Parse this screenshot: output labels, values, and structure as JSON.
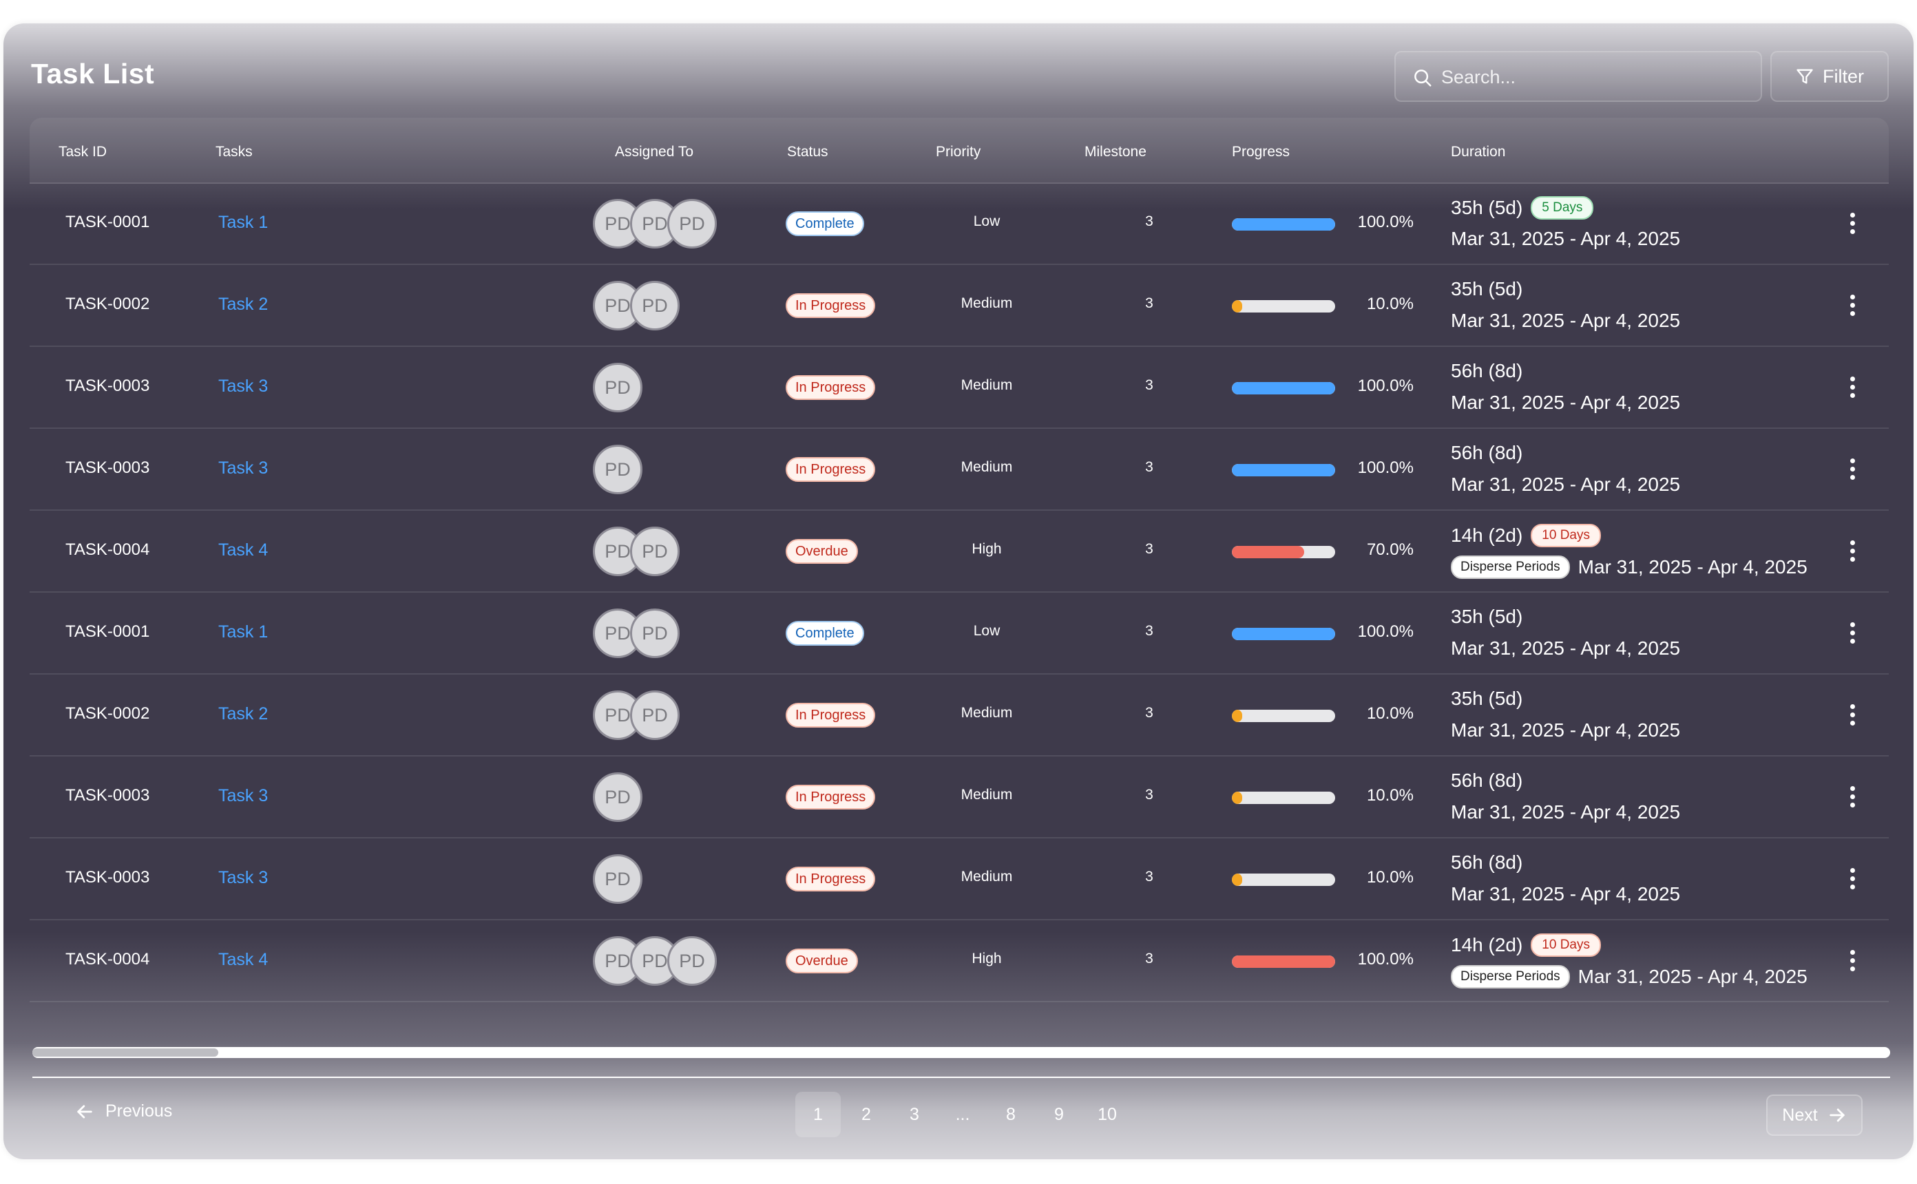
{
  "header": {
    "title": "Task List",
    "search_placeholder": "Search...",
    "filter_label": "Filter"
  },
  "columns": [
    "Task ID",
    "Tasks",
    "Assigned To",
    "Status",
    "Priority",
    "Milestone",
    "Progress",
    "Duration"
  ],
  "rows": [
    {
      "id": "TASK-0001",
      "task": "Task 1",
      "avatars": [
        "PD",
        "PD",
        "PD"
      ],
      "status": "Complete",
      "status_type": "complete",
      "priority": "Low",
      "milestone": "3",
      "progress": 1.0,
      "progress_color": "#4aa3ff",
      "progress_label": "100.0%",
      "duration": "35h (5d)",
      "days_badge": "5 Days",
      "days_badge_type": "green",
      "disperse": "",
      "dates": "Mar 31, 2025 - Apr 4, 2025"
    },
    {
      "id": "TASK-0002",
      "task": "Task 2",
      "avatars": [
        "PD",
        "PD"
      ],
      "status": "In Progress",
      "status_type": "progress",
      "priority": "Medium",
      "milestone": "3",
      "progress": 0.1,
      "progress_color": "#f5a623",
      "progress_label": "10.0%",
      "duration": "35h (5d)",
      "days_badge": "",
      "days_badge_type": "",
      "disperse": "",
      "dates": "Mar 31, 2025 - Apr 4, 2025"
    },
    {
      "id": "TASK-0003",
      "task": "Task 3",
      "avatars": [
        "PD"
      ],
      "status": "In Progress",
      "status_type": "progress",
      "priority": "Medium",
      "milestone": "3",
      "progress": 1.0,
      "progress_color": "#4aa3ff",
      "progress_label": "100.0%",
      "duration": "56h (8d)",
      "days_badge": "",
      "days_badge_type": "",
      "disperse": "",
      "dates": "Mar 31, 2025 - Apr 4, 2025"
    },
    {
      "id": "TASK-0003",
      "task": "Task 3",
      "avatars": [
        "PD"
      ],
      "status": "In Progress",
      "status_type": "progress",
      "priority": "Medium",
      "milestone": "3",
      "progress": 1.0,
      "progress_color": "#4aa3ff",
      "progress_label": "100.0%",
      "duration": "56h (8d)",
      "days_badge": "",
      "days_badge_type": "",
      "disperse": "",
      "dates": "Mar 31, 2025 - Apr 4, 2025"
    },
    {
      "id": "TASK-0004",
      "task": "Task 4",
      "avatars": [
        "PD",
        "PD"
      ],
      "status": "Overdue",
      "status_type": "overdue",
      "priority": "High",
      "milestone": "3",
      "progress": 0.7,
      "progress_color": "#f06a5e",
      "progress_label": "70.0%",
      "duration": "14h (2d)",
      "days_badge": "10 Days",
      "days_badge_type": "red",
      "disperse": "Disperse Periods",
      "dates": "Mar 31, 2025 - Apr 4, 2025"
    },
    {
      "id": "TASK-0001",
      "task": "Task 1",
      "avatars": [
        "PD",
        "PD"
      ],
      "status": "Complete",
      "status_type": "complete",
      "priority": "Low",
      "milestone": "3",
      "progress": 1.0,
      "progress_color": "#4aa3ff",
      "progress_label": "100.0%",
      "duration": "35h (5d)",
      "days_badge": "",
      "days_badge_type": "",
      "disperse": "",
      "dates": "Mar 31, 2025 - Apr 4, 2025"
    },
    {
      "id": "TASK-0002",
      "task": "Task 2",
      "avatars": [
        "PD",
        "PD"
      ],
      "status": "In Progress",
      "status_type": "progress",
      "priority": "Medium",
      "milestone": "3",
      "progress": 0.1,
      "progress_color": "#f5a623",
      "progress_label": "10.0%",
      "duration": "35h (5d)",
      "days_badge": "",
      "days_badge_type": "",
      "disperse": "",
      "dates": "Mar 31, 2025 - Apr 4, 2025"
    },
    {
      "id": "TASK-0003",
      "task": "Task 3",
      "avatars": [
        "PD"
      ],
      "status": "In Progress",
      "status_type": "progress",
      "priority": "Medium",
      "milestone": "3",
      "progress": 0.1,
      "progress_color": "#f5a623",
      "progress_label": "10.0%",
      "duration": "56h (8d)",
      "days_badge": "",
      "days_badge_type": "",
      "disperse": "",
      "dates": "Mar 31, 2025 - Apr 4, 2025"
    },
    {
      "id": "TASK-0003",
      "task": "Task 3",
      "avatars": [
        "PD"
      ],
      "status": "In Progress",
      "status_type": "progress",
      "priority": "Medium",
      "milestone": "3",
      "progress": 0.1,
      "progress_color": "#f5a623",
      "progress_label": "10.0%",
      "duration": "56h (8d)",
      "days_badge": "",
      "days_badge_type": "",
      "disperse": "",
      "dates": "Mar 31, 2025 - Apr 4, 2025"
    },
    {
      "id": "TASK-0004",
      "task": "Task 4",
      "avatars": [
        "PD",
        "PD",
        "PD"
      ],
      "status": "Overdue",
      "status_type": "overdue",
      "priority": "High",
      "milestone": "3",
      "progress": 1.0,
      "progress_color": "#f06a5e",
      "progress_label": "100.0%",
      "duration": "14h (2d)",
      "days_badge": "10 Days",
      "days_badge_type": "red",
      "disperse": "Disperse Periods",
      "dates": "Mar 31, 2025 - Apr 4, 2025"
    }
  ],
  "scrollbar": {
    "position": 0.0,
    "visible_fraction": 0.1
  },
  "pagination": {
    "previous_label": "Previous",
    "next_label": "Next",
    "pages": [
      "1",
      "2",
      "3",
      "...",
      "8",
      "9",
      "10"
    ],
    "active_page": "1"
  },
  "icons": {
    "search": "search-icon",
    "filter": "filter-icon",
    "prev": "arrow-left-icon",
    "next": "arrow-right-icon",
    "more": "more-vertical-icon"
  }
}
